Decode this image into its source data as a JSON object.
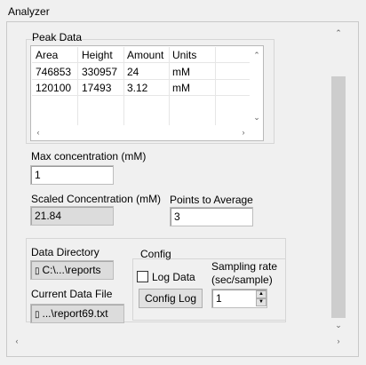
{
  "window": {
    "title": "Analyzer"
  },
  "peak_data": {
    "label": "Peak Data",
    "columns": [
      "Area",
      "Height",
      "Amount",
      "Units"
    ],
    "rows": [
      [
        "746853",
        "330957",
        "24",
        "mM"
      ],
      [
        "120100",
        "17493",
        "3.12",
        "mM"
      ]
    ]
  },
  "max_concentration": {
    "label": "Max concentration (mM)",
    "value": "1"
  },
  "scaled_concentration": {
    "label": "Scaled Concentration (mM)",
    "value": "21.84"
  },
  "points_to_average": {
    "label": "Points to Average",
    "value": "3"
  },
  "data_directory": {
    "label": "Data Directory",
    "value": "C:\\...\\reports",
    "icon": "path-icon"
  },
  "current_data_file": {
    "label": "Current Data File",
    "value": "...\\report69.txt",
    "icon": "path-icon"
  },
  "config": {
    "label": "Config",
    "log_data_label": "Log Data",
    "log_data_checked": false,
    "config_log_button": "Config Log",
    "sampling_rate_label_1": "Sampling rate",
    "sampling_rate_label_2": "(sec/sample)",
    "sampling_rate_value": "1"
  },
  "glyphs": {
    "up": "▲",
    "down": "▼",
    "left": "◀",
    "right": "▶",
    "small_up": "⌃",
    "small_down": "⌄",
    "small_left": "‹",
    "small_right": "›",
    "path": "▯"
  }
}
